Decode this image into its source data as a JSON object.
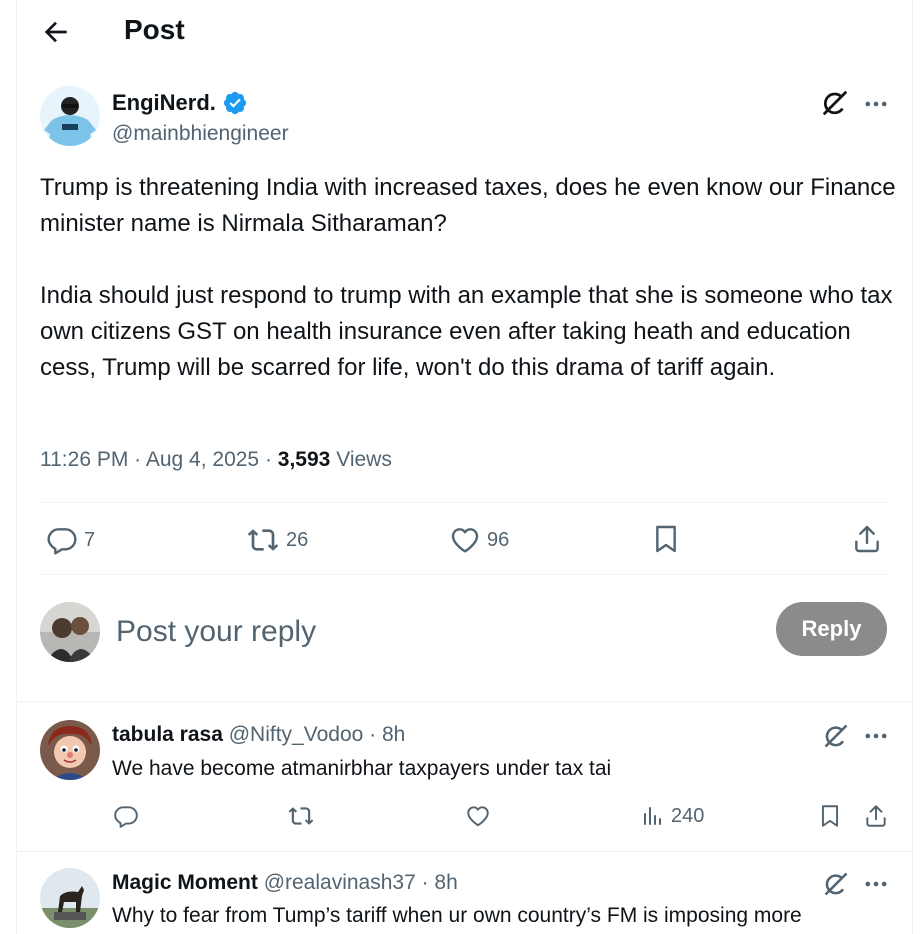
{
  "header": {
    "title": "Post",
    "back_icon": "arrow-left-icon"
  },
  "post": {
    "author_name": "EngiNerd.",
    "author_handle": "@mainbhiengineer",
    "verified_color": "#1d9bf0",
    "text": "Trump is threatening India with increased taxes, does he even know our Finance minister name is Nirmala Sitharaman?\n\nIndia should just respond to trump with an example that she is someone who tax own citizens GST on health insurance even after taking heath and education cess, Trump will be scarred for life, won't do this drama of tariff again.",
    "time": "11:26 PM",
    "date": "Aug 4, 2025",
    "views_count": "3,593",
    "views_label": "Views",
    "replies": "7",
    "reposts": "26",
    "likes": "96"
  },
  "composer": {
    "placeholder": "Post your reply",
    "button_label": "Reply"
  },
  "replies": [
    {
      "name": "tabula rasa",
      "handle": "@Nifty_Vodoo",
      "time": "· 8h",
      "text": "We have become atmanirbhar taxpayers under tax tai",
      "views": "240"
    },
    {
      "name": "Magic Moment",
      "handle": "@realavinash37",
      "time": "· 8h",
      "text": "Why to fear from Tump’s tariff when ur own country’s FM is imposing more"
    }
  ]
}
